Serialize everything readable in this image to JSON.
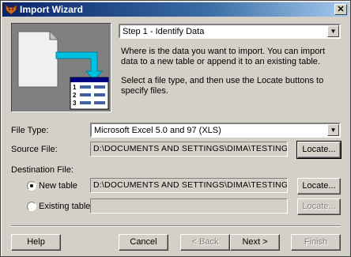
{
  "window": {
    "title": "Import Wizard"
  },
  "step": {
    "selected": "Step 1 - Identify Data"
  },
  "description": {
    "para1": "Where is the data you want to import. You can import data to a new table or append it to an existing table.",
    "para2": "Select a file type, and then use the Locate buttons to specify files."
  },
  "file_type": {
    "label": "File Type:",
    "value": "Microsoft Excel 5.0 and 97 (XLS)"
  },
  "source_file": {
    "label": "Source File:",
    "value": "D:\\DOCUMENTS AND SETTINGS\\DIMA\\TESTING\\MD",
    "locate": "Locate..."
  },
  "destination": {
    "label": "Destination File:",
    "new_table_label": "New table",
    "new_table_value": "D:\\DOCUMENTS AND SETTINGS\\DIMA\\TESTING\\MD",
    "new_table_locate": "Locate...",
    "new_table_selected": true,
    "existing_table_label": "Existing table",
    "existing_table_value": "",
    "existing_table_locate": "Locate..."
  },
  "buttons": {
    "help": "Help",
    "cancel": "Cancel",
    "back": "< Back",
    "next": "Next >",
    "finish": "Finish"
  },
  "icons": {
    "title": "fox-icon",
    "illustration": "import-illustration",
    "dropdown": "dropdown-arrow-icon"
  }
}
